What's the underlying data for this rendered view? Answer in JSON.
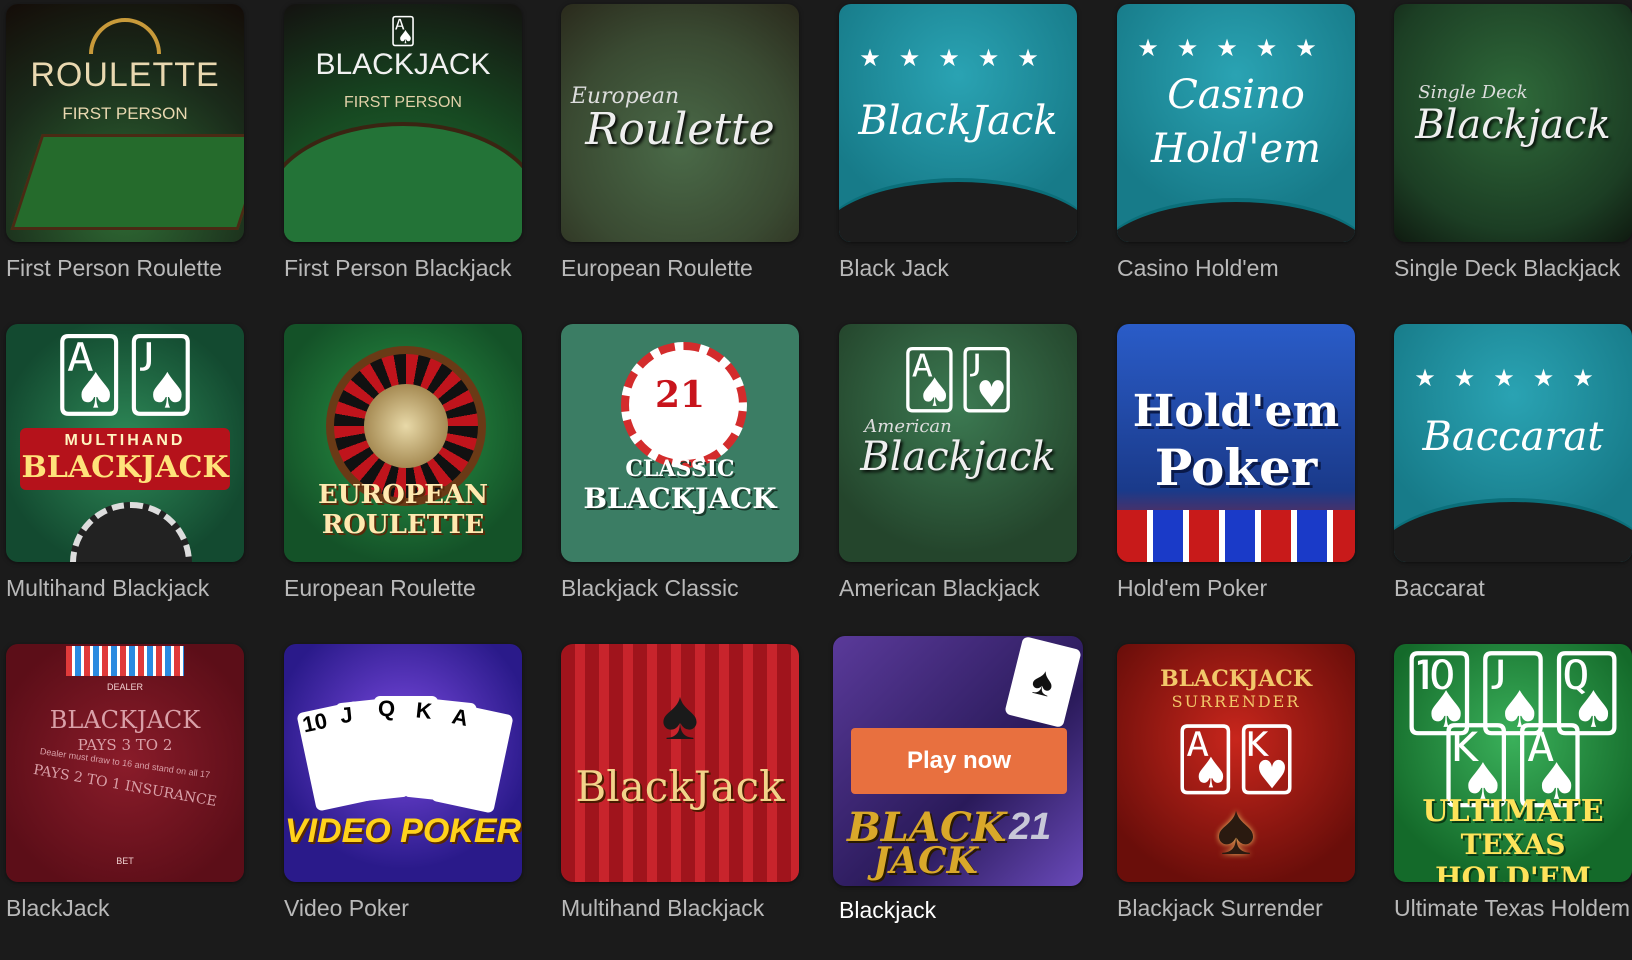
{
  "games": [
    {
      "title": "First Person Roulette",
      "art": [
        "ROULETTE",
        "FIRST PERSON"
      ]
    },
    {
      "title": "First Person Blackjack",
      "art": [
        "BLACKJACK",
        "FIRST PERSON"
      ]
    },
    {
      "title": "European Roulette",
      "art": [
        "European",
        "Roulette"
      ]
    },
    {
      "title": "Black Jack",
      "art": [
        "BlackJack"
      ]
    },
    {
      "title": "Casino Hold'em",
      "art": [
        "Casino",
        "Hold'em"
      ]
    },
    {
      "title": "Single Deck Blackjack",
      "art": [
        "Single Deck",
        "Blackjack"
      ]
    },
    {
      "title": "Multihand Blackjack",
      "art": [
        "MULTIHAND",
        "BLACKJACK"
      ]
    },
    {
      "title": "European Roulette",
      "art": [
        "EUROPEAN",
        "ROULETTE"
      ]
    },
    {
      "title": "Blackjack Classic",
      "art": [
        "21",
        "CLASSIC",
        "BLACKJACK"
      ]
    },
    {
      "title": "American Blackjack",
      "art": [
        "American",
        "Blackjack"
      ]
    },
    {
      "title": "Hold'em Poker",
      "art": [
        "Hold'em",
        "Poker"
      ]
    },
    {
      "title": "Baccarat",
      "art": [
        "Baccarat"
      ]
    },
    {
      "title": "BlackJack",
      "art": [
        "BLACKJACK",
        "PAYS 3 TO 2",
        "Dealer must draw to 16 and stand on all 17",
        "PAYS 2 TO 1 INSURANCE",
        "DEALER",
        "BET"
      ]
    },
    {
      "title": "Video Poker",
      "art": [
        "10",
        "J",
        "Q",
        "K",
        "A",
        "VIDEO POKER"
      ]
    },
    {
      "title": "Multihand Blackjack",
      "art": [
        "BlackJack"
      ]
    },
    {
      "title": "Blackjack",
      "art": [
        "BLACK",
        "JACK",
        "21"
      ]
    },
    {
      "title": "Blackjack Surrender",
      "art": [
        "BLACKJACK",
        "SURRENDER"
      ]
    },
    {
      "title": "Ultimate Texas Holdem",
      "art": [
        "ULTIMATE",
        "TEXAS HOLD'EM"
      ]
    }
  ],
  "play_button_label": "Play now",
  "colors": {
    "background": "#1b1b1b",
    "label": "#b9b9b9",
    "active_label": "#ffffff",
    "accent": "#e8703f",
    "felt_teal": "#1a8a9a"
  }
}
